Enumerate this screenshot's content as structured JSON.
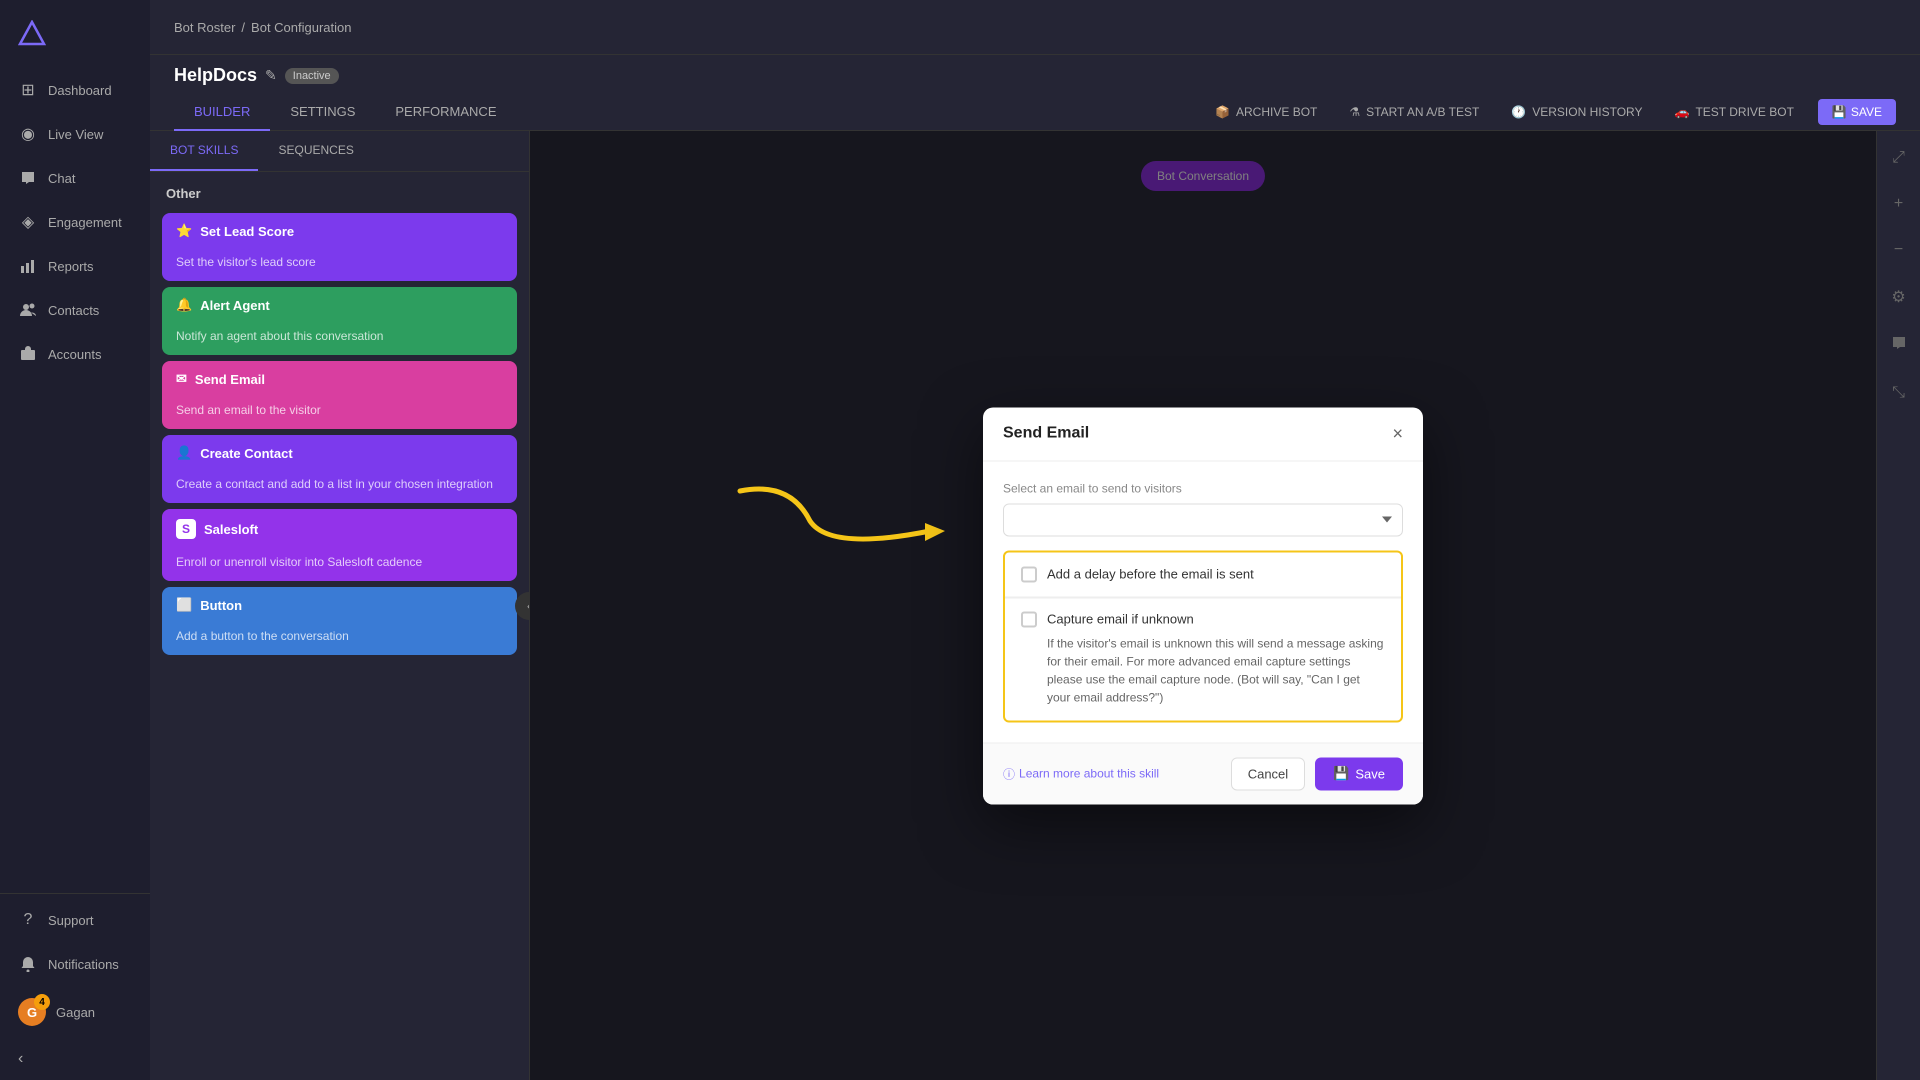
{
  "sidebar": {
    "logo": "△",
    "items": [
      {
        "id": "dashboard",
        "label": "Dashboard",
        "icon": "⊞"
      },
      {
        "id": "live-view",
        "label": "Live View",
        "icon": "◉"
      },
      {
        "id": "chat",
        "label": "Chat",
        "icon": "💬"
      },
      {
        "id": "engagement",
        "label": "Engagement",
        "icon": "◈"
      },
      {
        "id": "reports",
        "label": "Reports",
        "icon": "📊"
      },
      {
        "id": "contacts",
        "label": "Contacts",
        "icon": "👥"
      },
      {
        "id": "accounts",
        "label": "Accounts",
        "icon": "🏢"
      }
    ],
    "bottom_items": [
      {
        "id": "support",
        "label": "Support",
        "icon": "?"
      },
      {
        "id": "notifications",
        "label": "Notifications",
        "icon": "🔔"
      },
      {
        "id": "user",
        "label": "Gagan",
        "icon": "G"
      }
    ]
  },
  "breadcrumb": {
    "parent": "Bot Roster",
    "separator": "/",
    "current": "Bot Configuration"
  },
  "page_title": "HelpDocs",
  "status_badge": "Inactive",
  "tabs": [
    {
      "id": "builder",
      "label": "BUILDER",
      "active": true
    },
    {
      "id": "settings",
      "label": "SETTINGS",
      "active": false
    },
    {
      "id": "performance",
      "label": "PERFORMANCE",
      "active": false
    }
  ],
  "header_actions": [
    {
      "id": "archive",
      "label": "ARCHIVE BOT",
      "icon": "📦"
    },
    {
      "id": "ab-test",
      "label": "START AN A/B TEST",
      "icon": "⚗"
    },
    {
      "id": "version",
      "label": "VERSION HISTORY",
      "icon": "🕐"
    },
    {
      "id": "test-drive",
      "label": "TEST DRIVE BOT",
      "icon": "🚗"
    },
    {
      "id": "save",
      "label": "SAVE",
      "icon": "💾"
    }
  ],
  "skills_tabs": [
    {
      "id": "bot-skills",
      "label": "BOT SKILLS",
      "active": true
    },
    {
      "id": "sequences",
      "label": "SEQUENCES",
      "active": false
    }
  ],
  "skills_section_title": "Other",
  "skill_cards": [
    {
      "id": "set-lead-score",
      "title": "Set Lead Score",
      "description": "Set the visitor's lead score",
      "color": "purple",
      "icon": "⭐"
    },
    {
      "id": "alert-agent",
      "title": "Alert Agent",
      "description": "Notify an agent about this conversation",
      "color": "green",
      "icon": "🔔"
    },
    {
      "id": "send-email",
      "title": "Send Email",
      "description": "Send an email to the visitor",
      "color": "pink",
      "icon": "✉"
    },
    {
      "id": "create-contact",
      "title": "Create Contact",
      "description": "Create a contact and add to a list in your chosen integration",
      "color": "purple",
      "icon": "👤"
    },
    {
      "id": "salesloft",
      "title": "Salesloft",
      "description": "Enroll or unenroll visitor into Salesloft cadence",
      "color": "salesloft",
      "icon": "S"
    },
    {
      "id": "button",
      "title": "Button",
      "description": "Add a button to the conversation",
      "color": "blue",
      "icon": "⬜"
    }
  ],
  "modal": {
    "title": "Send Email",
    "close_icon": "×",
    "select_label": "Select an email to send to visitors",
    "select_placeholder": "",
    "delay_checkbox": {
      "label": "Add a delay before the email is sent",
      "checked": false
    },
    "capture_checkbox": {
      "label": "Capture email if unknown",
      "checked": false,
      "description": "If the visitor's email is unknown this will send a message asking for their email. For more advanced email capture settings please use the email capture node. (Bot will say, \"Can I get your email address?\")"
    },
    "learn_more": "Learn more about this skill",
    "cancel_btn": "Cancel",
    "save_btn": "Save"
  },
  "bot_node_label": "Bot Conversation",
  "user": {
    "name": "Gagan",
    "badge_count": "4"
  }
}
